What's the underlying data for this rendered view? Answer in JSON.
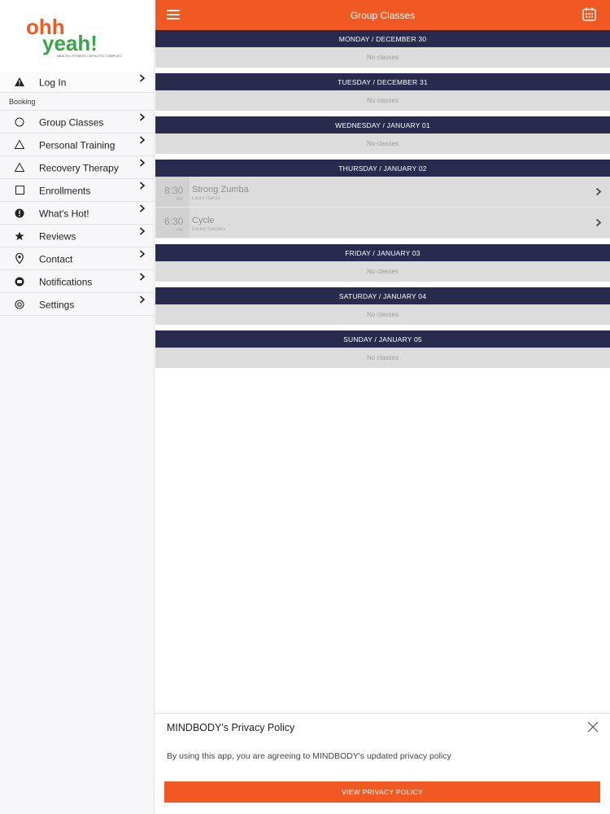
{
  "logo": {
    "line1": "ohh",
    "line2": "yeah!",
    "tagline": "HEALTH • FITNESS • ATHLETIC COMPLEX",
    "orange": "#f05a22",
    "green": "#3aa548"
  },
  "sidebar": {
    "login": {
      "label": "Log In",
      "icon": "warning-icon"
    },
    "section_label": "Booking",
    "items": [
      {
        "label": "Group Classes",
        "icon": "circle-icon"
      },
      {
        "label": "Personal Training",
        "icon": "triangle-icon"
      },
      {
        "label": "Recovery Therapy",
        "icon": "triangle-icon"
      },
      {
        "label": "Enrollments",
        "icon": "square-icon"
      },
      {
        "label": "What's Hot!",
        "icon": "exclamation-icon"
      },
      {
        "label": "Reviews",
        "icon": "star-icon"
      },
      {
        "label": "Contact",
        "icon": "location-pin-icon"
      },
      {
        "label": "Notifications",
        "icon": "chat-bubble-icon"
      },
      {
        "label": "Settings",
        "icon": "settings-ring-icon"
      }
    ]
  },
  "header": {
    "title": "Group Classes",
    "color": "#f05a22"
  },
  "schedule": {
    "header_color": "#292b4e",
    "days": [
      {
        "label": "MONDAY / DECEMBER 30",
        "empty_text": "No classes"
      },
      {
        "label": "TUESDAY / DECEMBER 31",
        "empty_text": "No classes"
      },
      {
        "label": "WEDNESDAY / JANUARY 01",
        "empty_text": "No classes"
      },
      {
        "label": "THURSDAY / JANUARY 02",
        "classes": [
          {
            "time": "8:30",
            "ampm": "AM",
            "name": "Strong Zumba",
            "teacher": "Laura Garcia"
          },
          {
            "time": "6:30",
            "ampm": "PM",
            "name": "Cycle",
            "teacher": "Daniel Sanders"
          }
        ]
      },
      {
        "label": "FRIDAY / JANUARY 03",
        "empty_text": "No classes"
      },
      {
        "label": "SATURDAY / JANUARY 04",
        "empty_text": "No classes"
      },
      {
        "label": "SUNDAY / JANUARY 05",
        "empty_text": "No classes"
      }
    ]
  },
  "privacy": {
    "title": "MINDBODY's Privacy Policy",
    "text": "By using this app, you are agreeing to MINDBODY's updated privacy policy",
    "button_label": "VIEW PRIVACY POLICY"
  }
}
